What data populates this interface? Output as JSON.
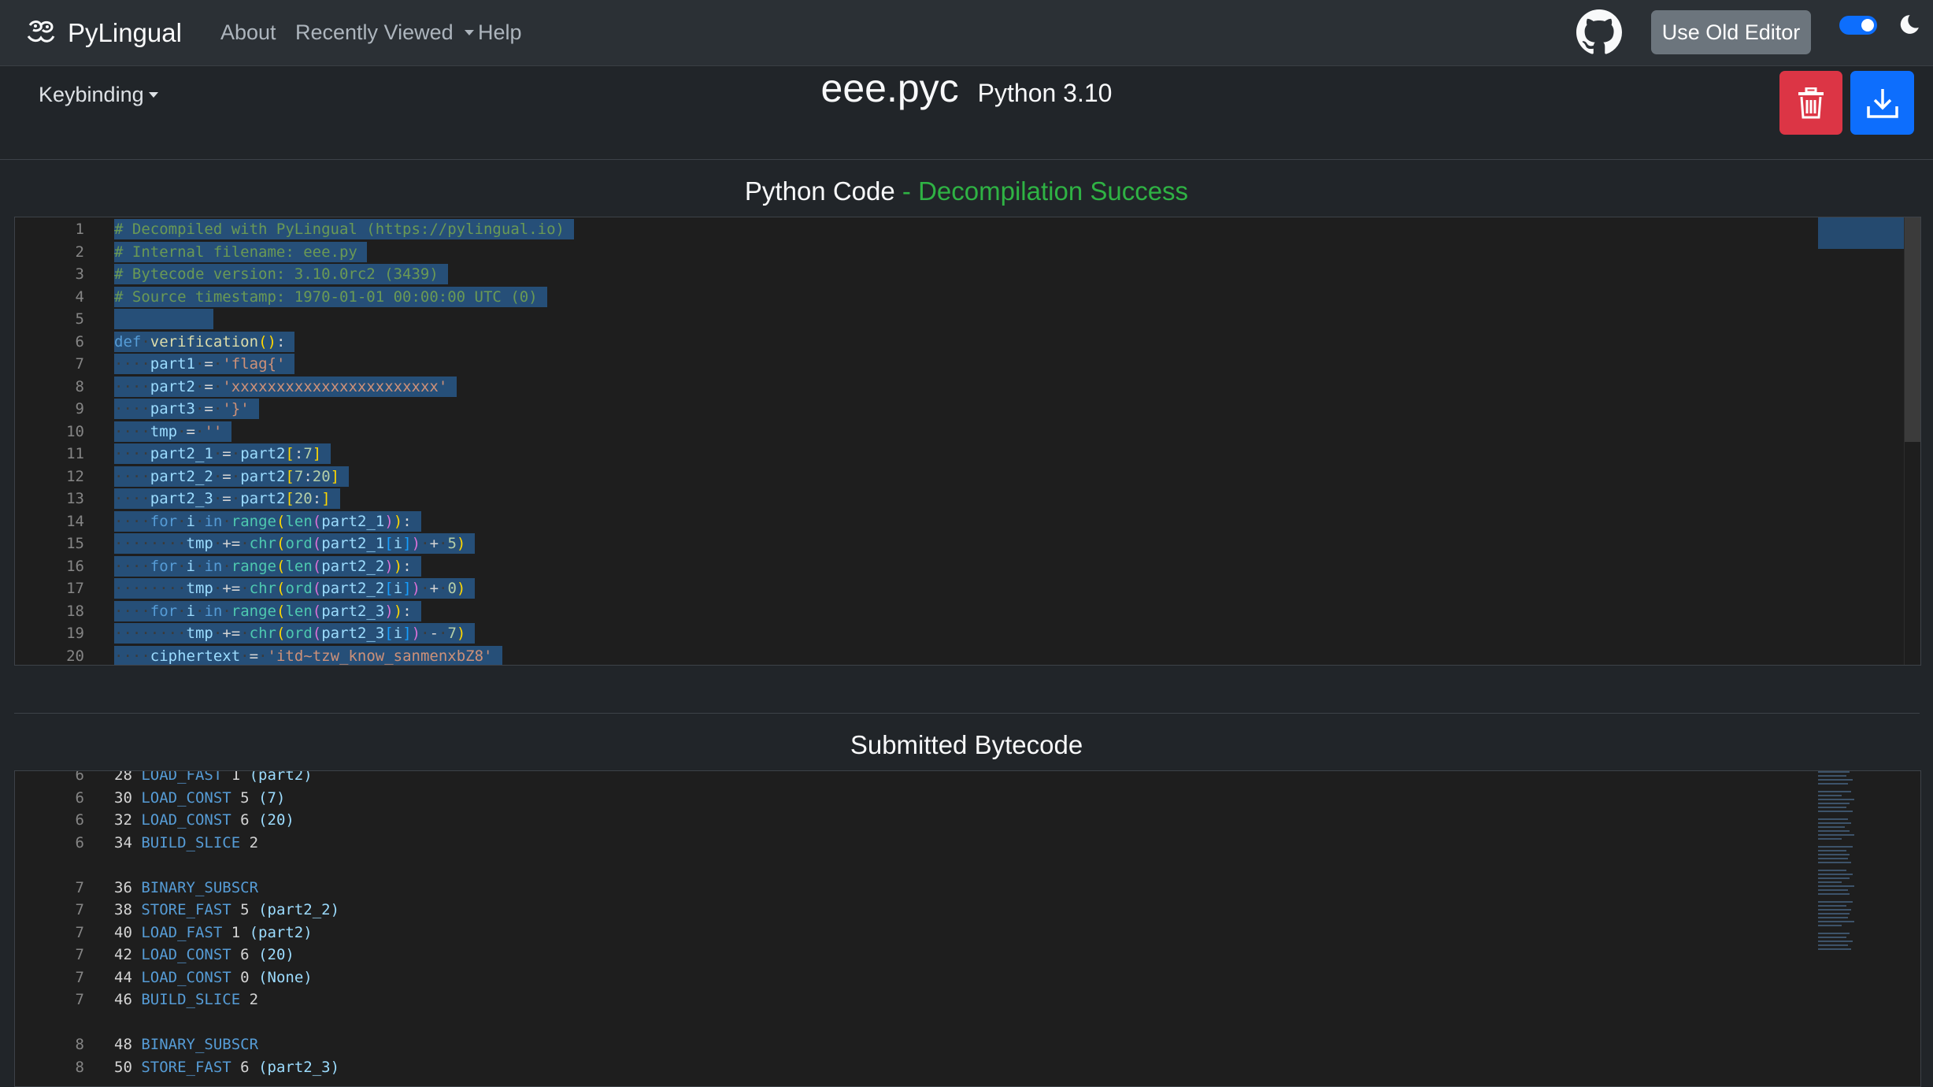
{
  "navbar": {
    "brand": "PyLingual",
    "links": {
      "about": "About",
      "recent": "Recently Viewed",
      "help": "Help"
    },
    "old_editor_label": "Use Old Editor"
  },
  "toolbar": {
    "keybinding_label": "Keybinding"
  },
  "file": {
    "name": "eee.pyc",
    "python_version": "Python 3.10"
  },
  "code_section": {
    "title": "Python Code",
    "status": "- Decompilation Success"
  },
  "bytecode_section": {
    "title": "Submitted Bytecode"
  },
  "code_editor": {
    "line_numbers": [
      "1",
      "2",
      "3",
      "4",
      "5",
      "6",
      "7",
      "8",
      "9",
      "10",
      "11",
      "12",
      "13",
      "14",
      "15",
      "16",
      "17",
      "18",
      "19",
      "20"
    ],
    "lines": [
      "# Decompiled with PyLingual (https://pylingual.io)",
      "# Internal filename: eee.py",
      "# Bytecode version: 3.10.0rc2 (3439)",
      "# Source timestamp: 1970-01-01 00:00:00 UTC (0)",
      "",
      "def verification():",
      "    part1 = 'flag{'",
      "    part2 = 'xxxxxxxxxxxxxxxxxxxxxxx'",
      "    part3 = '}'",
      "    tmp = ''",
      "    part2_1 = part2[:7]",
      "    part2_2 = part2[7:20]",
      "    part2_3 = part2[20:]",
      "    for i in range(len(part2_1)):",
      "        tmp += chr(ord(part2_1[i]) + 5)",
      "    for i in range(len(part2_2)):",
      "        tmp += chr(ord(part2_2[i]) + 0)",
      "    for i in range(len(part2_3)):",
      "        tmp += chr(ord(part2_3[i]) - 7)",
      "    ciphertext = 'itd~tzw_know_sanmenxbZ8'"
    ]
  },
  "bytecode_editor": {
    "rows": [
      {
        "line": "6",
        "offset": "28",
        "op": "LOAD_FAST",
        "arg": "1",
        "ref": "(part2)"
      },
      {
        "line": "6",
        "offset": "30",
        "op": "LOAD_CONST",
        "arg": "5",
        "ref": "(7)"
      },
      {
        "line": "6",
        "offset": "32",
        "op": "LOAD_CONST",
        "arg": "6",
        "ref": "(20)"
      },
      {
        "line": "6",
        "offset": "34",
        "op": "BUILD_SLICE",
        "arg": "2",
        "ref": ""
      },
      {
        "line": "",
        "offset": "",
        "op": "",
        "arg": "",
        "ref": ""
      },
      {
        "line": "7",
        "offset": "36",
        "op": "BINARY_SUBSCR",
        "arg": "",
        "ref": ""
      },
      {
        "line": "7",
        "offset": "38",
        "op": "STORE_FAST",
        "arg": "5",
        "ref": "(part2_2)"
      },
      {
        "line": "7",
        "offset": "40",
        "op": "LOAD_FAST",
        "arg": "1",
        "ref": "(part2)"
      },
      {
        "line": "7",
        "offset": "42",
        "op": "LOAD_CONST",
        "arg": "6",
        "ref": "(20)"
      },
      {
        "line": "7",
        "offset": "44",
        "op": "LOAD_CONST",
        "arg": "0",
        "ref": "(None)"
      },
      {
        "line": "7",
        "offset": "46",
        "op": "BUILD_SLICE",
        "arg": "2",
        "ref": ""
      },
      {
        "line": "",
        "offset": "",
        "op": "",
        "arg": "",
        "ref": ""
      },
      {
        "line": "8",
        "offset": "48",
        "op": "BINARY_SUBSCR",
        "arg": "",
        "ref": ""
      },
      {
        "line": "8",
        "offset": "50",
        "op": "STORE_FAST",
        "arg": "6",
        "ref": "(part2_3)"
      }
    ]
  },
  "colors": {
    "success": "#2fb344",
    "danger": "#dc3545",
    "primary": "#0d6efd",
    "secondary": "#6c757d"
  }
}
